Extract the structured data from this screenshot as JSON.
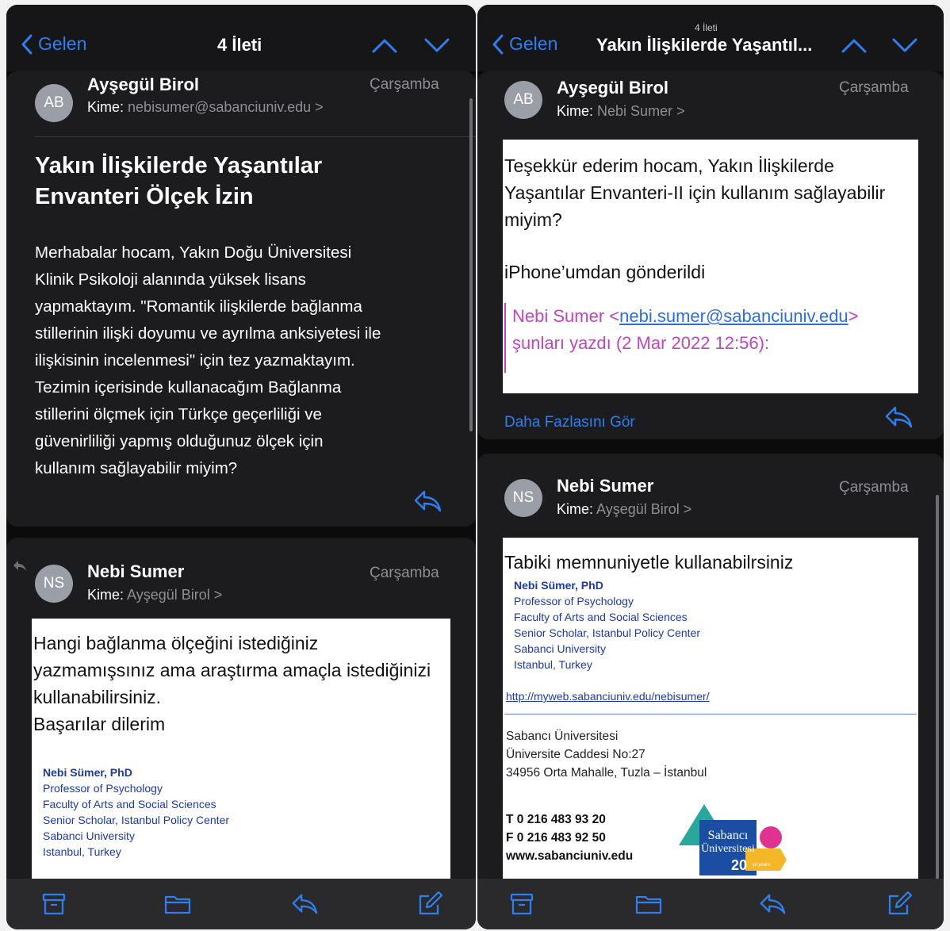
{
  "left": {
    "nav": {
      "back_label": "Gelen",
      "title": "4 İleti"
    },
    "msg1": {
      "initials": "AB",
      "sender": "Ayşegül Birol",
      "to_label": "Kime:",
      "to_value": "nebisumer@sabanciuniv.edu >",
      "date": "Çarşamba",
      "subject_line1": "Yakın İlişkilerde Yaşantılar",
      "subject_line2": "Envanteri Ölçek İzin",
      "body": [
        "Merhabalar hocam, Yakın Doğu Üniversitesi",
        "Klinik Psikoloji alanında yüksek lisans",
        "yapmaktayım. \"Romantik ilişkilerde bağlanma",
        "stillerinin ilişki doyumu ve ayrılma anksiyetesi ile",
        "ilişkisinin incelenmesi\" için tez yazmaktayım.",
        "Tezimin içerisinde kullanacağım Bağlanma",
        "stillerini ölçmek için Türkçe geçerliliği ve",
        "güvenirliliği yapmış olduğunuz ölçek için",
        "kullanım sağlayabilir miyim?"
      ]
    },
    "msg2": {
      "initials": "NS",
      "sender": "Nebi Sumer",
      "to_label": "Kime:",
      "to_value": "Ayşegül Birol >",
      "date": "Çarşamba",
      "body": [
        "Hangi bağlanma ölçeğini istediğiniz",
        "yazmamışsınız ama araştırma amaçla istediğinizi",
        "kullanabilirsiniz.",
        "Başarılar dilerim"
      ],
      "signature": [
        "Nebi Sümer, PhD",
        "Professor of Psychology",
        "Faculty of Arts and Social Sciences",
        "Senior Scholar,  Istanbul Policy Center",
        "Sabanci University",
        "Istanbul, Turkey"
      ]
    }
  },
  "right": {
    "nav": {
      "back_label": "Gelen",
      "subtitle": "4 İleti",
      "title": "Yakın İlişkilerde Yaşantıl..."
    },
    "msg1": {
      "initials": "AB",
      "sender": "Ayşegül Birol",
      "to_label": "Kime:",
      "to_value": "Nebi Sumer >",
      "date": "Çarşamba",
      "body": [
        "Teşekkür ederim hocam, Yakın İlişkilerde",
        "Yaşantılar Envanteri-II için kullanım sağlayabilir",
        "miyim?"
      ],
      "sent_from": "iPhone’umdan gönderildi",
      "quote_name": "Nebi Sumer <",
      "quote_email": "nebi.sumer@sabanciuniv.edu",
      "quote_close": ">",
      "quote_line2": "şunları yazdı (2 Mar 2022 12:56):",
      "more_label": "Daha Fazlasını Gör"
    },
    "msg2": {
      "initials": "NS",
      "sender": "Nebi Sumer",
      "to_label": "Kime:",
      "to_value": "Ayşegül Birol >",
      "date": "Çarşamba",
      "body": "Tabiki memnuniyetle kullanabilrsiniz",
      "signature": [
        "Nebi Sümer, PhD",
        "Professor of Psychology",
        "Faculty of Arts and Social Sciences",
        "Senior Scholar,  Istanbul Policy Center",
        "Sabanci University",
        "Istanbul, Turkey"
      ],
      "link": "http://myweb.sabanciuniv.edu/nebisumer/",
      "address": [
        "Sabancı Üniversitesi",
        "Üniversite Caddesi No:27",
        "34956 Orta Mahalle, Tuzla – İstanbul"
      ],
      "phone": "T  0 216 483 93 20",
      "fax": "F  0 216 483 92 50",
      "web": "www.sabanciuniv.edu",
      "logo_text1": "Sabancı",
      "logo_text2": "Üniversitesi",
      "logo_num": "20",
      "logo_small": "yıl years"
    }
  },
  "icons": [
    "chevron-left-icon",
    "chevron-up-icon",
    "chevron-down-icon",
    "reply-icon",
    "archive-icon",
    "folder-icon",
    "compose-icon"
  ],
  "colors": {
    "accent": "#2f7ff0",
    "background": "#0b0b0c",
    "card": "#1c1c1e",
    "quote": "#c044c0"
  }
}
